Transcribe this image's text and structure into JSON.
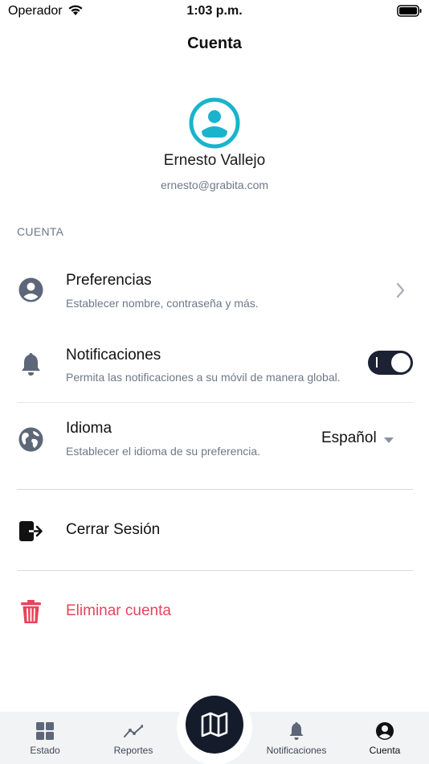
{
  "status_bar": {
    "carrier": "Operador",
    "time": "1:03 p.m."
  },
  "header": {
    "title": "Cuenta"
  },
  "profile": {
    "name": "Ernesto Vallejo",
    "email": "ernesto@grabita.com",
    "avatar_icon": "user-avatar-icon",
    "accent_color": "#19b4cc"
  },
  "section": {
    "label": "CUENTA"
  },
  "settings": {
    "preferences": {
      "title": "Preferencias",
      "subtitle": "Establecer nombre, contraseña y más.",
      "icon": "user-circle-icon"
    },
    "notifications": {
      "title": "Notificaciones",
      "subtitle": "Permita las notificaciones a su móvil de manera global.",
      "icon": "bell-icon",
      "enabled": true
    },
    "language": {
      "title": "Idioma",
      "subtitle": "Establecer el idioma de su preferencia.",
      "icon": "globe-icon",
      "value": "Español"
    }
  },
  "actions": {
    "logout": {
      "label": "Cerrar Sesión",
      "icon": "logout-icon"
    },
    "delete": {
      "label": "Eliminar cuenta",
      "icon": "trash-icon",
      "color": "#e8445a"
    }
  },
  "tabbar": {
    "tabs": [
      {
        "label": "Estado",
        "icon": "grid-icon"
      },
      {
        "label": "Reportes",
        "icon": "trend-icon"
      },
      {
        "label": "",
        "icon": "map-icon"
      },
      {
        "label": "Notificaciones",
        "icon": "bell-icon"
      },
      {
        "label": "Cuenta",
        "icon": "user-icon",
        "active": true
      }
    ]
  }
}
